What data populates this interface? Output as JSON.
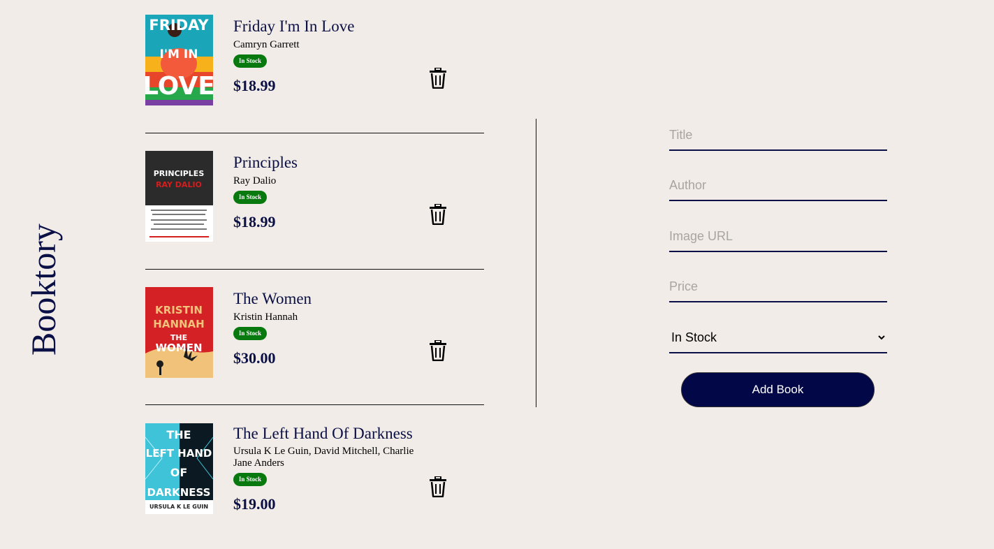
{
  "app": {
    "brand": "Booktory"
  },
  "books": [
    {
      "title": "Friday I'm In Love",
      "author": "Camryn Garrett",
      "status": "In Stock",
      "price": "$18.99",
      "cover": {
        "lines": [
          "FRIDAY",
          "I'M  IN",
          "LOVE"
        ],
        "colors": [
          "#1aa6b8",
          "#e8462a",
          "#f7b21b",
          "#7a3fa3"
        ]
      }
    },
    {
      "title": "Principles",
      "author": "Ray Dalio",
      "status": "In Stock",
      "price": "$18.99",
      "cover": {
        "lines": [
          "PRINCIPLES",
          "RAY DALIO"
        ],
        "colors": [
          "#2b2b2b",
          "#d41d1d",
          "#ffffff"
        ]
      }
    },
    {
      "title": "The Women",
      "author": "Kristin Hannah",
      "status": "In Stock",
      "price": "$30.00",
      "cover": {
        "lines": [
          "KRISTIN",
          "HANNAH",
          "THE",
          "WOMEN"
        ],
        "colors": [
          "#d42125",
          "#f0c27a",
          "#1b1b1b"
        ]
      }
    },
    {
      "title": "The Left Hand Of Darkness",
      "author": "Ursula K Le Guin, David Mitchell, Charlie Jane Anders",
      "status": "In Stock",
      "price": "$19.00",
      "cover": {
        "lines": [
          "THE",
          "LEFT HAND",
          "OF",
          "DARKNESS",
          "URSULA K LE GUIN"
        ],
        "colors": [
          "#3fc3d9",
          "#0b1a22",
          "#ffffff"
        ]
      }
    }
  ],
  "form": {
    "title_placeholder": "Title",
    "author_placeholder": "Author",
    "image_placeholder": "Image URL",
    "price_placeholder": "Price",
    "status_selected": "In Stock",
    "submit_label": "Add Book"
  },
  "colors": {
    "background": "#f1ece7",
    "primary": "#0a0f45",
    "badge": "#08790f",
    "button": "#020847"
  },
  "icons": {
    "delete": "trash-icon",
    "select": "chevron-down-icon"
  }
}
